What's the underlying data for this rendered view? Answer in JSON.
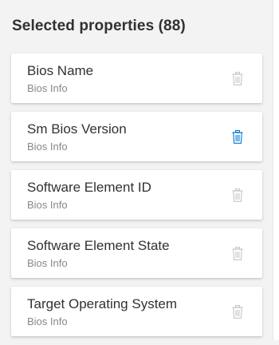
{
  "header": {
    "title": "Selected properties (88)"
  },
  "colors": {
    "icon_muted": "#c8c6c4",
    "icon_active": "#0078d4"
  },
  "properties": [
    {
      "name": "Bios Name",
      "category": "Bios Info",
      "icon": "trash-icon",
      "icon_state": "muted"
    },
    {
      "name": "Sm Bios Version",
      "category": "Bios Info",
      "icon": "trash-icon",
      "icon_state": "active"
    },
    {
      "name": "Software Element ID",
      "category": "Bios Info",
      "icon": "trash-icon",
      "icon_state": "muted"
    },
    {
      "name": "Software Element State",
      "category": "Bios Info",
      "icon": "trash-icon",
      "icon_state": "muted"
    },
    {
      "name": "Target Operating System",
      "category": "Bios Info",
      "icon": "trash-icon",
      "icon_state": "muted"
    }
  ]
}
